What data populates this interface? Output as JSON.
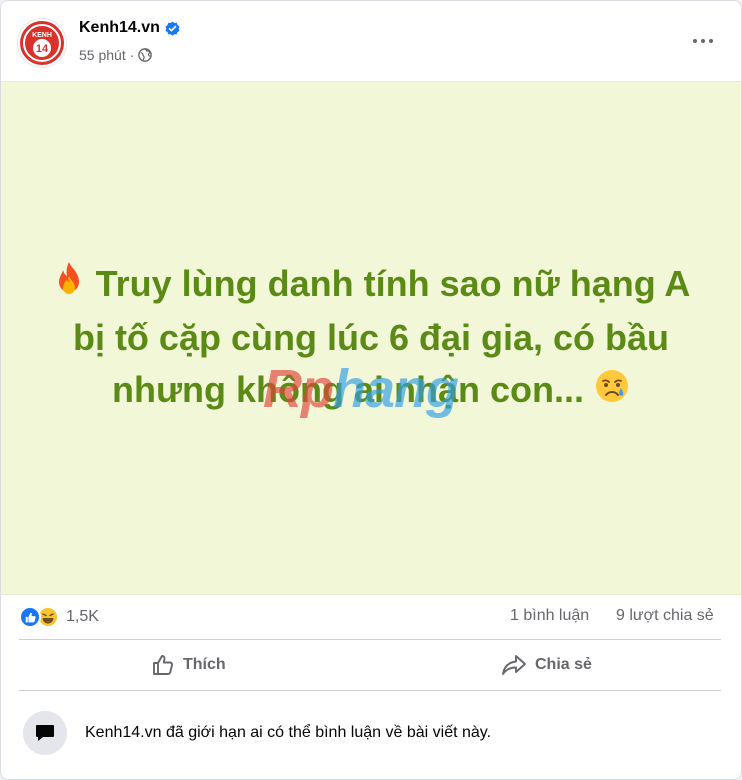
{
  "post": {
    "page_name": "Kenh14.vn",
    "timestamp": "55 phút",
    "separator": "·",
    "avatar_text": "KENH",
    "avatar_number": "14",
    "text_line1": "Truy lùng danh tính sao nữ hạng A",
    "text_line2": "bị tố cặp cùng lúc 6 đại gia, có bầu",
    "text_line3": "nhưng không ai nhận con...",
    "emoji_start": "fire-emoji",
    "emoji_end": "crying-face-emoji",
    "background_color": "#f2f7d8",
    "text_color": "#5c8a16"
  },
  "watermark": {
    "part1": "Rp",
    "part2": "hang"
  },
  "stats": {
    "reaction_count": "1,5K",
    "comments": "1 bình luận",
    "shares": "9 lượt chia sẻ"
  },
  "actions": {
    "like_label": "Thích",
    "share_label": "Chia sẻ"
  },
  "notice": {
    "text": "Kenh14.vn đã giới hạn ai có thể bình luận về bài viết này."
  },
  "colors": {
    "accent_blue": "#1877f2",
    "muted": "#65676b",
    "brand_red": "#d8322b"
  }
}
